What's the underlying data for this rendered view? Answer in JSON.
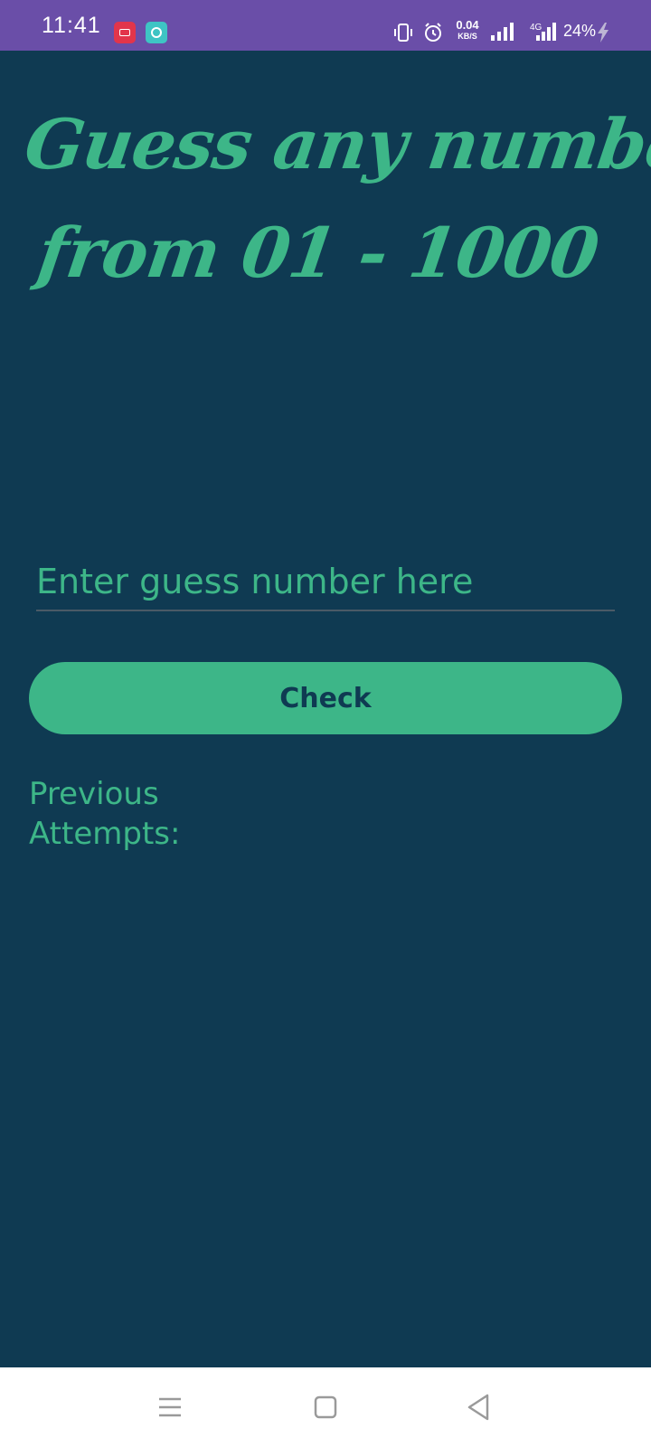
{
  "status_bar": {
    "time": "11:41",
    "net_speed_value": "0.04",
    "net_speed_unit": "KB/S",
    "network_type": "4G",
    "battery": "24%",
    "background_color": "#6a4ea8",
    "icons": [
      "screen-record-icon",
      "chat-app-icon",
      "vibrate-icon",
      "alarm-icon",
      "signal-icon",
      "signal-4g-icon",
      "charging-icon"
    ]
  },
  "main": {
    "title_line1": "Guess any number",
    "title_line2": "from 01 - 1000",
    "input_placeholder": "Enter guess number here",
    "input_value": "",
    "check_button_label": "Check",
    "previous_attempts_label": "Previous Attempts:",
    "colors": {
      "background": "#0f3a52",
      "accent": "#3db688"
    }
  },
  "nav_bar": {
    "icons": [
      "menu-icon",
      "home-icon",
      "back-icon"
    ]
  }
}
